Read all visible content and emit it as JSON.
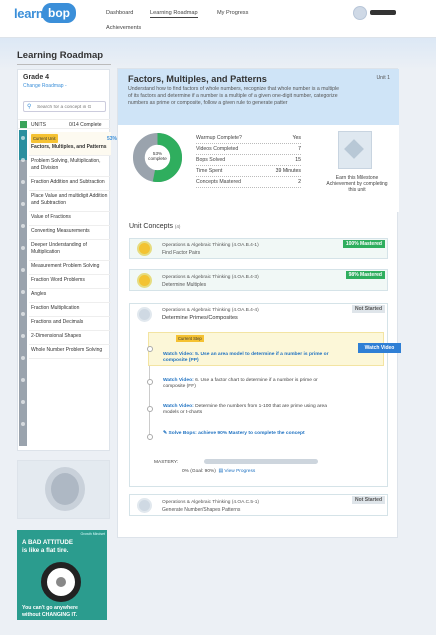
{
  "header": {
    "logo_left": "learn",
    "logo_right": "bop",
    "nav": [
      "Dashboard",
      "Learning Roadmap",
      "My Progress",
      "Achievements"
    ],
    "active_nav": "Learning Roadmap"
  },
  "page_title": "Learning Roadmap",
  "sidebar": {
    "grade": "Grade 4",
    "change_link": "Change Roadmap -",
    "search_placeholder": "Search for a concept in G",
    "units_label": "UNITS",
    "units_count": "0/14 Complete",
    "current_badge": "Current Unit",
    "current_pct": "53%",
    "units": [
      "Factors, Multiples, and Patterns",
      "Problem Solving, Multiplication, and Division",
      "Fraction Addition and Subtraction",
      "Place Value and multidigit Addition and Subtraction",
      "Value of Fractions",
      "Converting Measurements",
      "Deeper Understanding of Multiplication",
      "Measurement Problem Solving",
      "Fraction Word Problems",
      "Angles",
      "Fraction Multiplication",
      "Fractions and Decimals",
      "2-Dimensional Shapes",
      "Whole Number Problem Solving"
    ]
  },
  "ad": {
    "tag": "Growth Mindset",
    "line1": "A BAD ATTITUDE",
    "line2": "is like a flat tire.",
    "line3": "You can't go anywhere",
    "line4": "without CHANGING IT."
  },
  "main": {
    "title": "Factors, Multiples, and Patterns",
    "unit_label": "Unit 1",
    "description": "Understand how to find factors of whole numbers, recognize that whole number is a multiple of its factors and determine if a number is a multiple of a given one-digit number, categorize numbers as prime or composite, follow a given rule to generate patter",
    "donut_pct": "53%",
    "donut_label": "complete",
    "donut_fraction": 0.53,
    "stats": [
      {
        "k": "Warmup Complete?",
        "v": "Yes"
      },
      {
        "k": "Videos Completed",
        "v": "7"
      },
      {
        "k": "Bops Solved",
        "v": "15"
      },
      {
        "k": "Time Spent",
        "v": "39 Minutes"
      },
      {
        "k": "Concepts Mastered",
        "v": "2"
      }
    ],
    "milestone_text": "Earn this Milestone Achievement by completing this unit",
    "concepts_heading": "Unit Concepts",
    "concepts_count": "(4)",
    "concepts": [
      {
        "code": "Operations & Algebraic Thinking (4.OA.B.4-1)",
        "name": "Find Factor Pairs",
        "status": "100% Mastered"
      },
      {
        "code": "Operations & Algebraic Thinking (4.OA.B.4-3)",
        "name": "Determine Multiples",
        "status": "98% Mastered"
      },
      {
        "code": "Operations & Algebraic Thinking (4.OA.B.4-4)",
        "name": "Determine Primes/Composites",
        "status": "Not Started"
      },
      {
        "code": "Operations & Algebraic Thinking (4.OA.C.5-1)",
        "name": "Generate Number/Shapes Patterns",
        "status": "Not Started"
      }
    ],
    "steps": {
      "current_label": "Current Step",
      "watch_button": "Watch Video",
      "v1_prefix": "Watch Video:",
      "v1": "5. Use an area model to determine if a number is prime or composite (PP)",
      "v2_prefix": "Watch Video:",
      "v2": "6. Use a factor chart to determine if a number is prime or composite (FF)",
      "v3_prefix": "Watch Video:",
      "v3": "Determine the numbers from 1-100 that are prime using area models or t-charts",
      "solve_prefix": "Solve Bops:",
      "solve": "achieve 90% Mastery to complete the concept",
      "mastery_label": "MASTERY:",
      "mastery_value": "0% (Goal: 90%)",
      "view_progress": "View Progress"
    }
  }
}
